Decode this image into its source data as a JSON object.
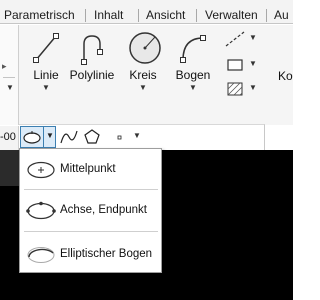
{
  "tabs": [
    {
      "label": "Parametrisch"
    },
    {
      "label": "Inhalt"
    },
    {
      "label": "Ansicht"
    },
    {
      "label": "Verwalten"
    },
    {
      "label": "Au"
    }
  ],
  "ribbon": {
    "tools": [
      {
        "label": "Linie",
        "icon": "line-icon"
      },
      {
        "label": "Polylinie",
        "icon": "polyline-icon"
      },
      {
        "label": "Kreis",
        "icon": "circle-icon"
      },
      {
        "label": "Bogen",
        "icon": "arc-icon"
      }
    ],
    "small_tools": [
      {
        "icon": "construction-line-icon"
      },
      {
        "icon": "rectangle-icon"
      },
      {
        "icon": "hatch-icon"
      }
    ],
    "truncated_label": "Ko",
    "left_edge_text": "-00"
  },
  "menu": {
    "items": [
      {
        "label": "Mittelpunkt",
        "icon": "ellipse-center-icon"
      },
      {
        "label": "Achse, Endpunkt",
        "icon": "ellipse-axis-end-icon"
      },
      {
        "label": "Elliptischer Bogen",
        "icon": "elliptical-arc-icon"
      }
    ]
  },
  "colors": {
    "accent": "#3c7fb1",
    "accent_fill": "#dcebf8",
    "canvas": "#000000"
  }
}
